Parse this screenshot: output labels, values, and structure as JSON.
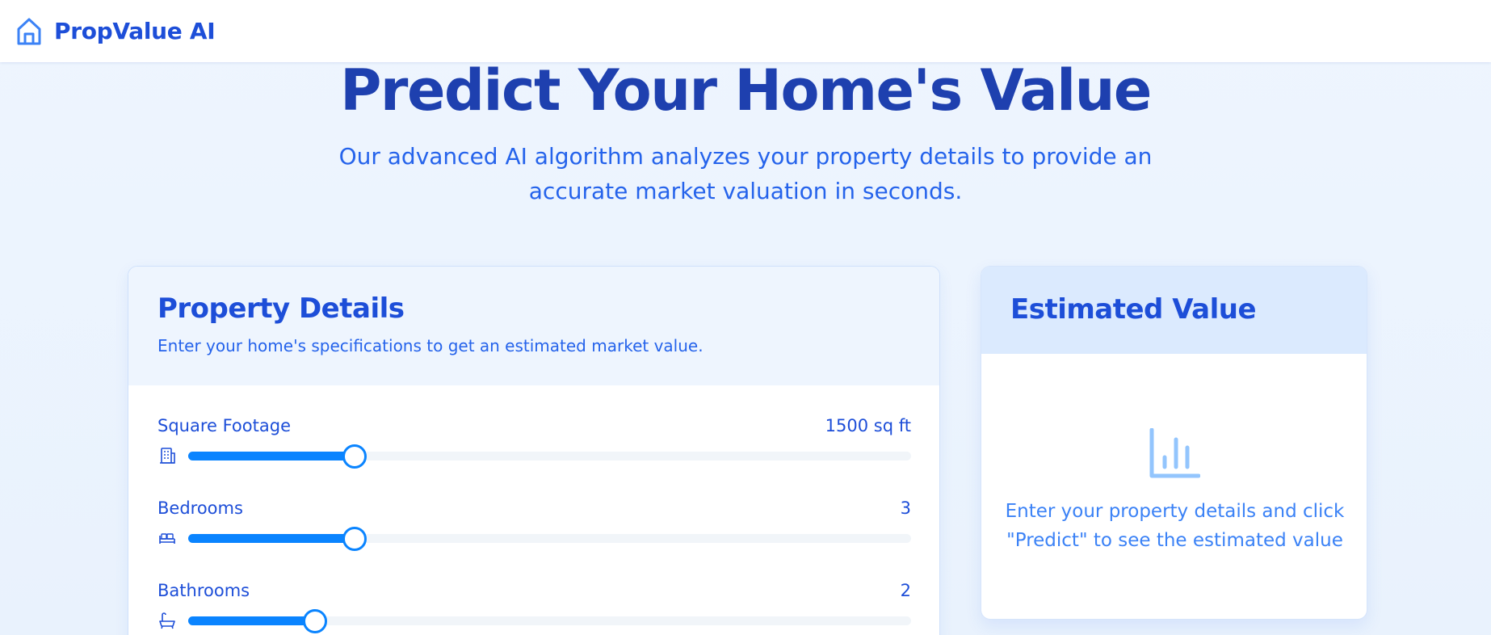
{
  "header": {
    "brand_name": "PropValue AI",
    "logo_icon": "home-icon"
  },
  "hero": {
    "title": "Predict Your Home's Value",
    "subtitle_line1": "Our advanced AI algorithm analyzes your property details to provide an",
    "subtitle_line2": "accurate market valuation in seconds."
  },
  "property_details": {
    "title": "Property Details",
    "description": "Enter your home's specifications to get an estimated market value.",
    "fields": [
      {
        "label": "Square Footage",
        "value_display": "1500 sq ft",
        "icon": "building-icon",
        "fill_fraction": 0.23
      },
      {
        "label": "Bedrooms",
        "value_display": "3",
        "icon": "bed-icon",
        "fill_fraction": 0.23
      },
      {
        "label": "Bathrooms",
        "value_display": "2",
        "icon": "bath-icon",
        "fill_fraction": 0.175
      }
    ]
  },
  "estimated_value": {
    "title": "Estimated Value",
    "icon": "bar-chart-icon",
    "placeholder_line1": "Enter your property details and click",
    "placeholder_line2": "\"Predict\" to see the estimated value"
  },
  "colors": {
    "primary": "#1d4ed8",
    "accent": "#0a84ff",
    "track": "#f1f5f9",
    "header_tint": "#dbeafe"
  }
}
